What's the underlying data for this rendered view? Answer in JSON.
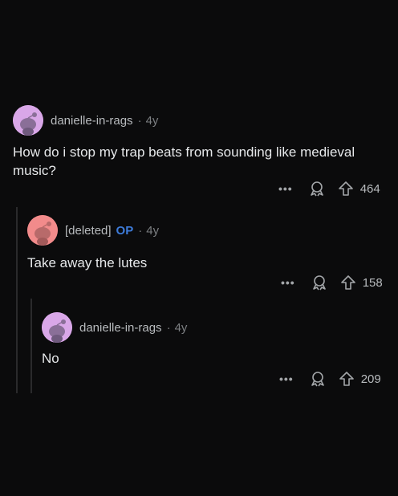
{
  "comments": [
    {
      "username": "danielle-in-rags",
      "op": "",
      "separator": "·",
      "age": "4y",
      "body": "How do i stop my trap beats from sounding like medieval music?",
      "more": "•••",
      "votes": "464",
      "avatar_color": "#d9a7e8"
    },
    {
      "username": "[deleted]",
      "op": "OP",
      "separator": "·",
      "age": "4y",
      "body": "Take away the lutes",
      "more": "•••",
      "votes": "158",
      "avatar_color": "#f28b8b"
    },
    {
      "username": "danielle-in-rags",
      "op": "",
      "separator": "·",
      "age": "4y",
      "body": "No",
      "more": "•••",
      "votes": "209",
      "avatar_color": "#d9a7e8"
    }
  ],
  "icons": {
    "more": "more-options-icon",
    "award": "award-icon",
    "upvote": "upvote-arrow-icon"
  },
  "colors": {
    "background": "#0b0b0c",
    "op_accent": "#3d7bd9",
    "thread_line": "#2a2a2c"
  }
}
